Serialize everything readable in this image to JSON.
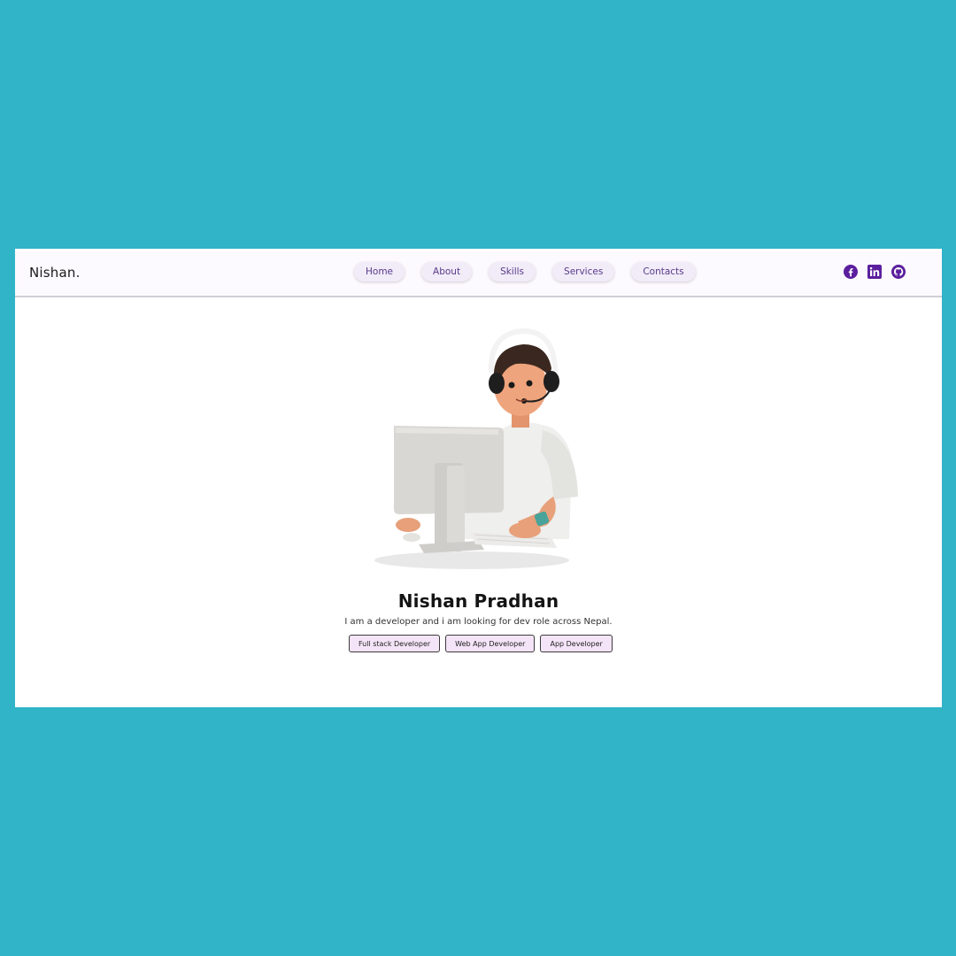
{
  "nav": {
    "brand": "Nishan.",
    "links": [
      "Home",
      "About",
      "Skills",
      "Services",
      "Contacts"
    ],
    "socials": [
      "facebook-icon",
      "linkedin-icon",
      "github-icon"
    ]
  },
  "hero": {
    "name": "Nishan Pradhan",
    "tagline": "I am a developer and i am looking for dev role across Nepal.",
    "roles": [
      "Full stack Developer",
      "Web App Developer",
      "App Developer"
    ]
  },
  "colors": {
    "background": "#31b3c8",
    "accent": "#5b1f9e",
    "pill": "#f1ecf8",
    "role_button": "#f4e4f7"
  }
}
